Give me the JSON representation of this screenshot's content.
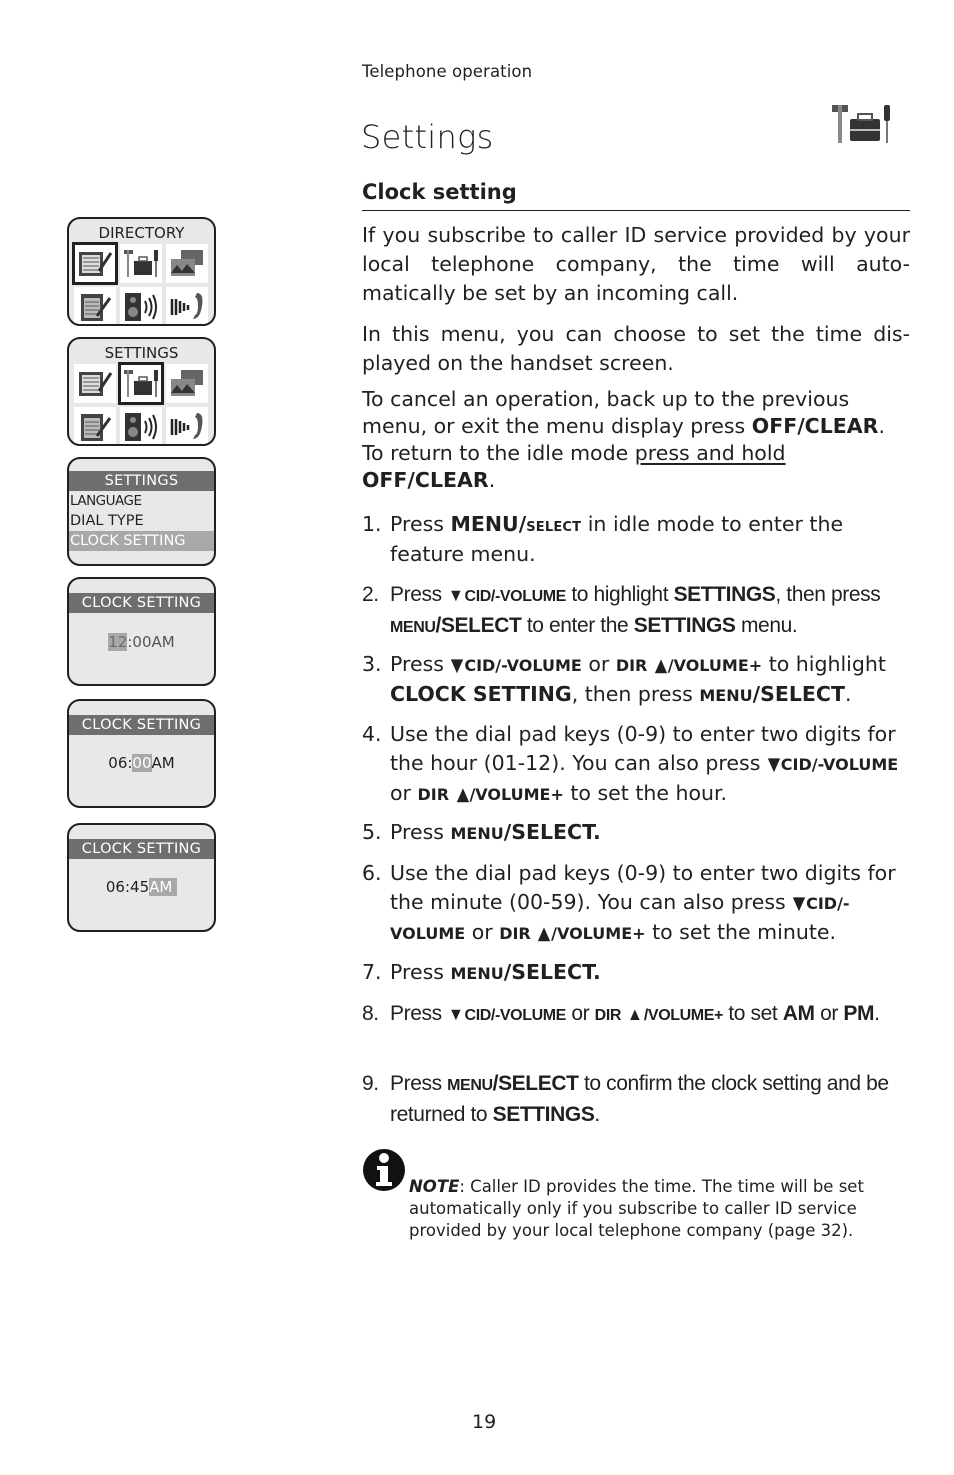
{
  "header": {
    "running_head": "Telephone operation",
    "page_title": "Settings",
    "title_icon": "settings-tools-icon"
  },
  "section": {
    "heading": "Clock setting"
  },
  "intro": {
    "p1": "If you subscribe to caller ID service provided by your local telephone company, the time will auto-matically be set by an incoming call.",
    "p2": "In this menu, you can choose to set the time dis-played on the handset screen.",
    "p3": {
      "a": "To cancel an operation, back up to the previous menu, or exit the menu display press ",
      "b": "OFF/CLEAR",
      "c": ". To return to the idle mode ",
      "d": "press and hold",
      "e": "OFF/CLEAR",
      "f": "."
    }
  },
  "keys": {
    "down": "▼",
    "up": "▲",
    "cid_volume": "CID/-VOLUME",
    "dir": "DIR",
    "volume_plus": "/VOLUME+",
    "menu": "MENU",
    "select": "/SELECT",
    "select_sc": "SELECT",
    "menu_select_bold": "MENU/",
    "settings": "SETTINGS",
    "clock_setting": "CLOCK SETTING",
    "am": "AM",
    "pm": "PM",
    "or": " or "
  },
  "steps": [
    {
      "num": "1.",
      "pre": "Press ",
      "post": " in idle mode to enter the feature menu."
    },
    {
      "num": "2.",
      "pre": "Press ",
      "mid1": " to highlight ",
      "mid2": ", then press ",
      "mid3": " to enter the ",
      "post": " menu."
    },
    {
      "num": "3.",
      "pre": "Press ",
      "mid1": " to highlight ",
      "mid2": ", then press ",
      "post": "."
    },
    {
      "num": "4.",
      "pre": "Use the dial pad keys (0-9) to enter two digits for the hour (01-12). You can also press ",
      "post": " to set the hour."
    },
    {
      "num": "5.",
      "pre": "Press ",
      "post": "."
    },
    {
      "num": "6.",
      "pre": "Use the dial pad keys (0-9) to enter two digits for the minute (00-59). You can also press ",
      "post": " to set the minute."
    },
    {
      "num": "7.",
      "pre": "Press ",
      "post": "."
    },
    {
      "num": "8.",
      "pre": "Press ",
      "mid1": " to set ",
      "post": "."
    },
    {
      "num": "9.",
      "pre": "Press ",
      "mid1": " to confirm the clock setting and be returned to ",
      "post": "."
    }
  ],
  "note": {
    "icon": "info-icon",
    "label": "NOTE",
    "text": ": Caller ID provides the time. The time will be set automatically only if you subscribe to caller ID service provided by your local telephone company (page 32)."
  },
  "page_number": "19",
  "screens": [
    {
      "title": "DIRECTORY",
      "icons": [
        "directory-book-icon",
        "settings-tools-icon",
        "photos-icon",
        "notepad-icon",
        "speaker-icon",
        "ringer-phone-icon"
      ],
      "selected_index": 0
    },
    {
      "title": "SETTINGS",
      "icons": [
        "directory-book-icon",
        "settings-tools-icon",
        "photos-icon",
        "notepad-icon",
        "speaker-icon",
        "ringer-phone-icon"
      ],
      "selected_index": 1
    },
    {
      "title": "SETTINGS",
      "items": [
        "LANGUAGE",
        "DIAL TYPE",
        "CLOCK SETTING"
      ],
      "highlighted": "CLOCK SETTING"
    },
    {
      "title": "CLOCK SETTING",
      "time_before": "",
      "time_cursor": "12",
      "time_after": ":00AM"
    },
    {
      "title": "CLOCK SETTING",
      "time_before": "06:",
      "time_cursor": "00",
      "time_after": "AM"
    },
    {
      "title": "CLOCK SETTING",
      "time_before": "06:45",
      "time_cursor": "AM ",
      "time_after": ""
    }
  ],
  "colors": {
    "text": "#231f20",
    "screen_bg": "#e8e8e8",
    "title_bar": "#6e6e6e",
    "highlight": "#a8a8a8"
  }
}
